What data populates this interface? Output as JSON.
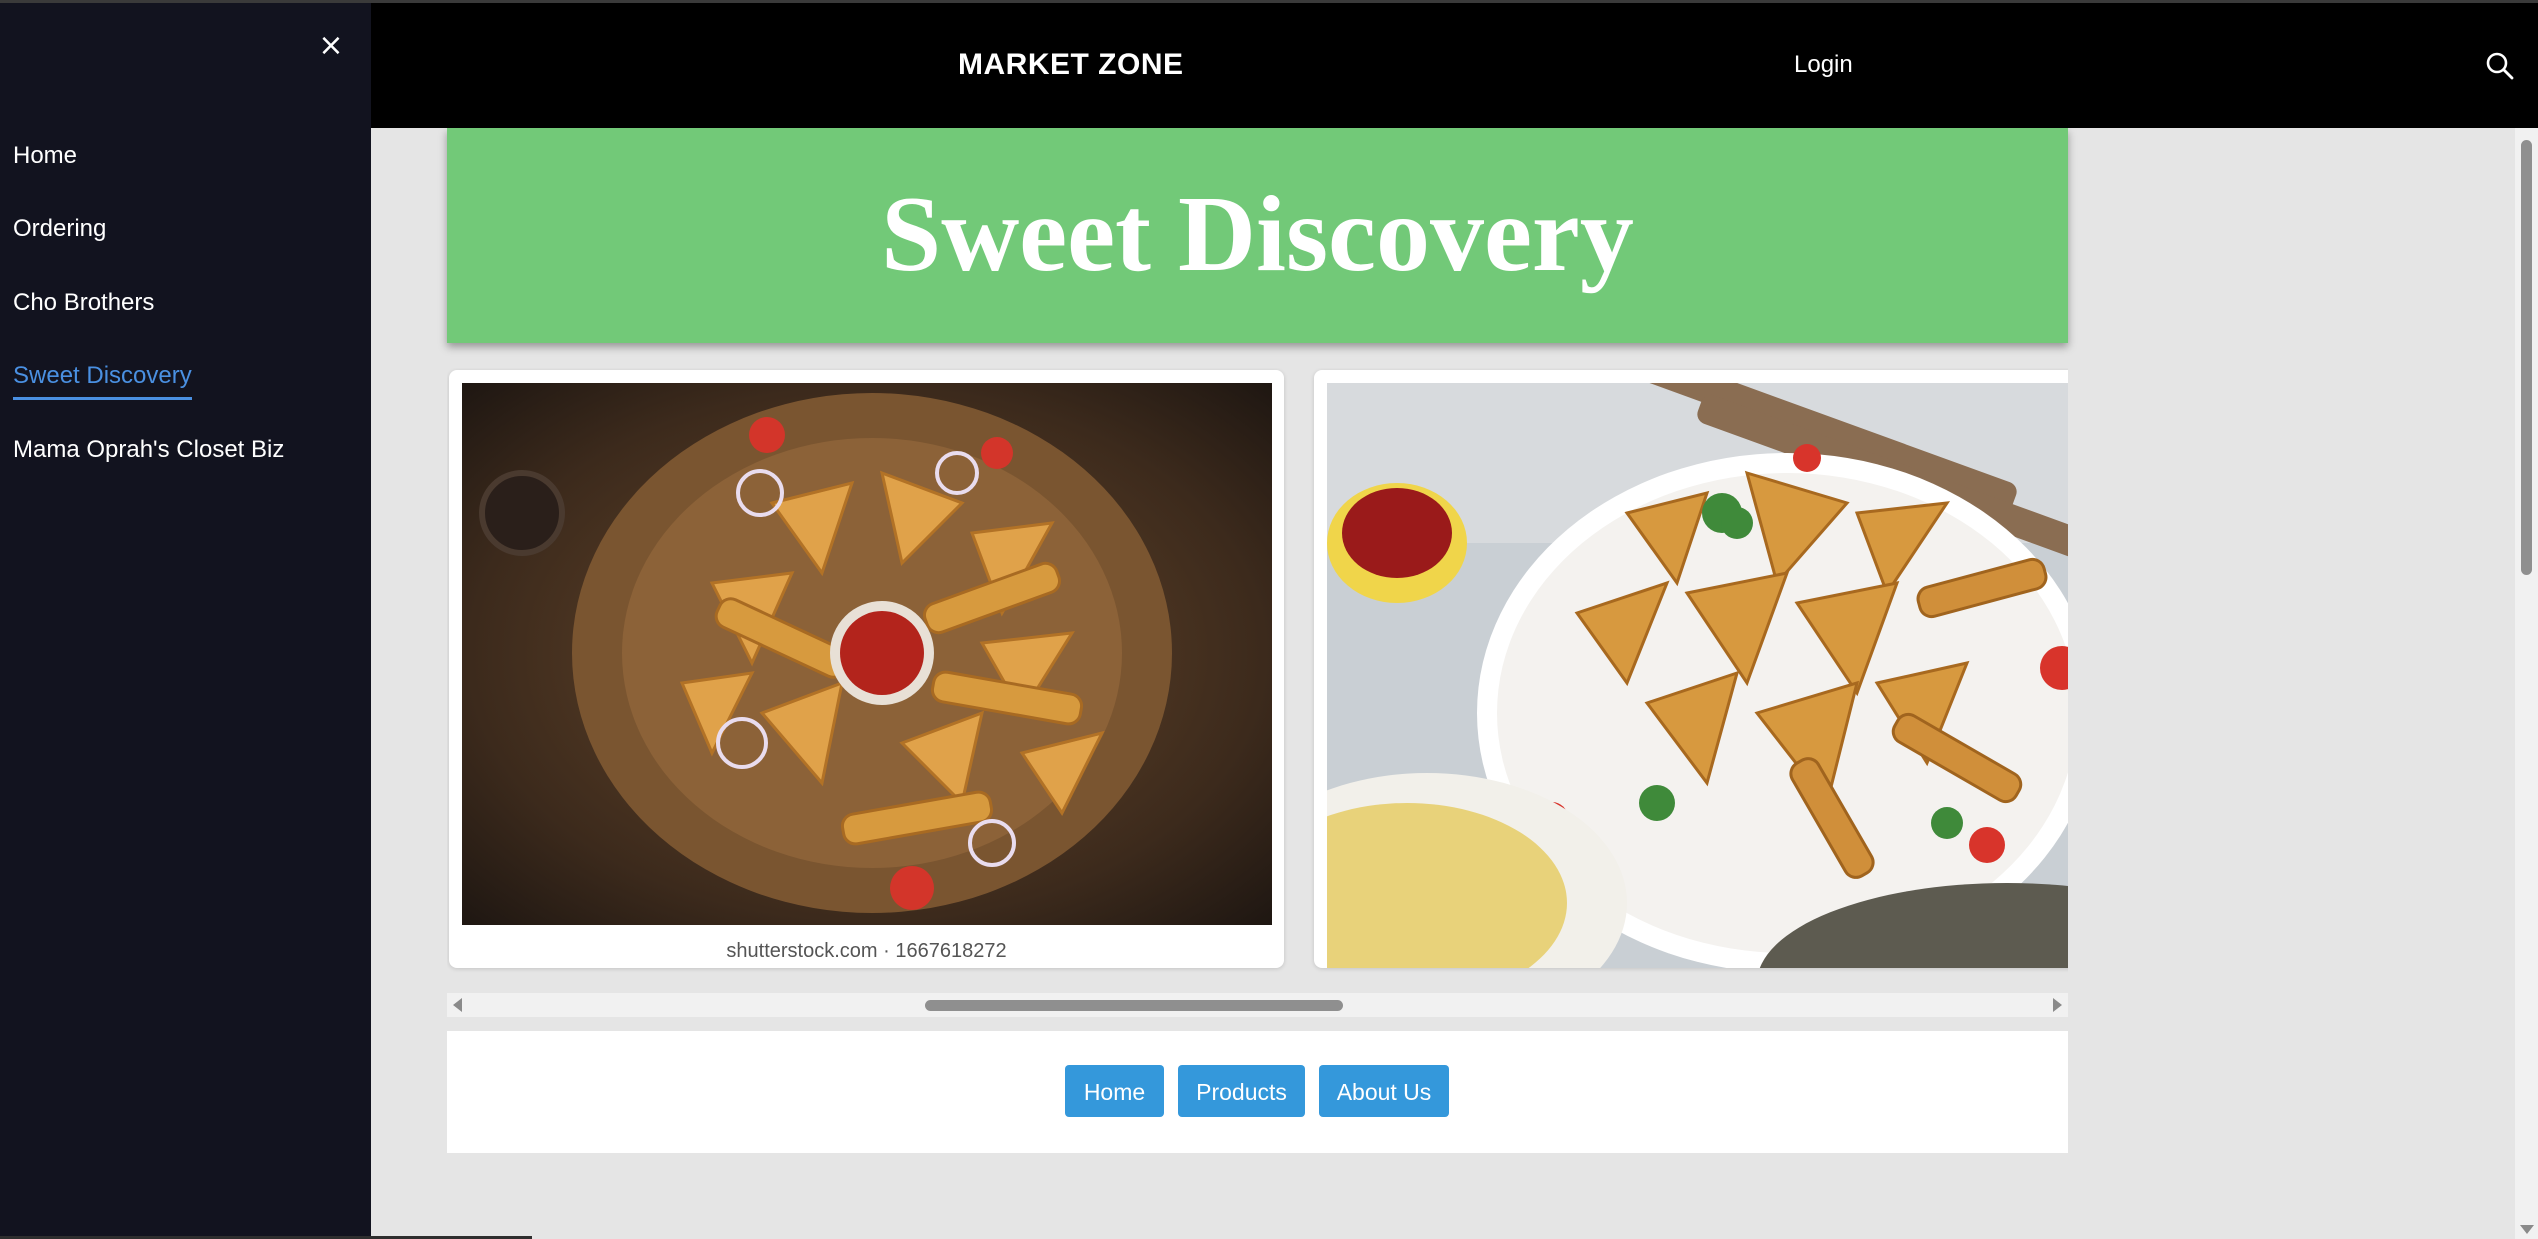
{
  "header": {
    "brand": "MARKET ZONE",
    "login_label": "Login",
    "search_icon": "search-icon"
  },
  "sidebar": {
    "close_symbol": "×",
    "items": [
      {
        "label": "Home"
      },
      {
        "label": "Ordering"
      },
      {
        "label": "Cho Brothers"
      },
      {
        "label": "Sweet Discovery",
        "active": true
      },
      {
        "label": "Mama Oprah's Closet Biz"
      }
    ]
  },
  "main": {
    "banner_title": "Sweet Discovery",
    "gallery": [
      {
        "image": "samosa-platter-photo",
        "caption": "shutterstock.com · 1667618272"
      },
      {
        "image": "samosa-plate-photo"
      }
    ]
  },
  "footer": {
    "buttons": [
      {
        "label": "Home"
      },
      {
        "label": "Products"
      },
      {
        "label": "About Us"
      }
    ]
  },
  "colors": {
    "sidebar_bg": "#12131f",
    "active_link": "#4a90e2",
    "banner_bg": "#72c978",
    "button_bg": "#3498db"
  }
}
